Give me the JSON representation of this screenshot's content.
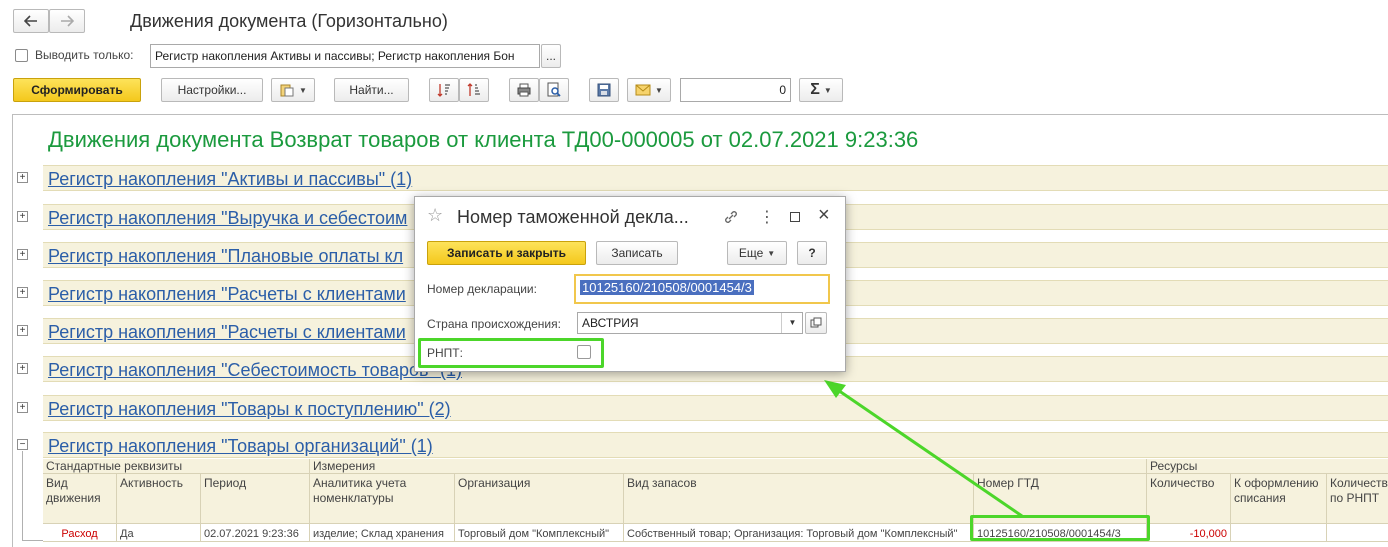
{
  "window": {
    "title": "Движения документа (Горизонтально)"
  },
  "filter": {
    "label": "Выводить только:",
    "value": "Регистр накопления Активы и пассивы; Регистр накопления Бон",
    "more": "..."
  },
  "toolbar": {
    "generate": "Сформировать",
    "settings": "Настройки...",
    "find": "Найти...",
    "number_value": "0",
    "sum_symbol": "Σ"
  },
  "report": {
    "title": "Движения документа Возврат товаров от клиента ТД00-000005 от 02.07.2021 9:23:36",
    "registers": [
      {
        "label": "Регистр накопления \"Активы и пассивы\" (1)"
      },
      {
        "label": "Регистр накопления \"Выручка и себестоим"
      },
      {
        "label": "Регистр накопления \"Плановые оплаты кл"
      },
      {
        "label": "Регистр накопления \"Расчеты с клиентами"
      },
      {
        "label": "Регистр накопления \"Расчеты с клиентами"
      },
      {
        "label": "Регистр накопления \"Себестоимость товаров\" (1)"
      },
      {
        "label": "Регистр накопления \"Товары к поступлению\" (2)"
      },
      {
        "label": "Регистр накопления \"Товары организаций\" (1)"
      }
    ],
    "table": {
      "group_standard": "Стандартные реквизиты",
      "group_dimensions": "Измерения",
      "group_resources": "Ресурсы",
      "col_movement_type": "Вид движения",
      "col_activity": "Активность",
      "col_period": "Период",
      "col_nomenclature": "Аналитика учета номенклатуры",
      "col_organization": "Организация",
      "col_stock_type": "Вид запасов",
      "col_gtd": "Номер ГТД",
      "col_quantity": "Количество",
      "col_to_writeoff": "К оформлению списания",
      "col_qty_rnpt": "Количество по РНПТ",
      "row": {
        "movement_type": "Расход",
        "activity": "Да",
        "period": "02.07.2021 9:23:36",
        "nomenclature": "изделие; Склад хранения",
        "organization": "Торговый дом \"Комплексный\"",
        "stock_type": "Собственный товар; Организация: Торговый дом \"Комплексный\"",
        "gtd": "10125160/210508/0001454/3",
        "quantity": "-10,000"
      }
    }
  },
  "dialog": {
    "title": "Номер таможенной декла...",
    "save_close": "Записать и закрыть",
    "save": "Записать",
    "more": "Еще",
    "help": "?",
    "decl_label": "Номер декларации:",
    "decl_value": "10125160/210508/0001454/3",
    "country_label": "Страна происхождения:",
    "country_value": "АВСТРИЯ",
    "rnpt_label": "РНПТ:"
  },
  "colors": {
    "accent_yellow": "#f4c81c",
    "title_green": "#1b9a3e",
    "link_blue": "#2b5ea8",
    "highlight_green": "#4cd62a",
    "negative_red": "#cc0000"
  }
}
